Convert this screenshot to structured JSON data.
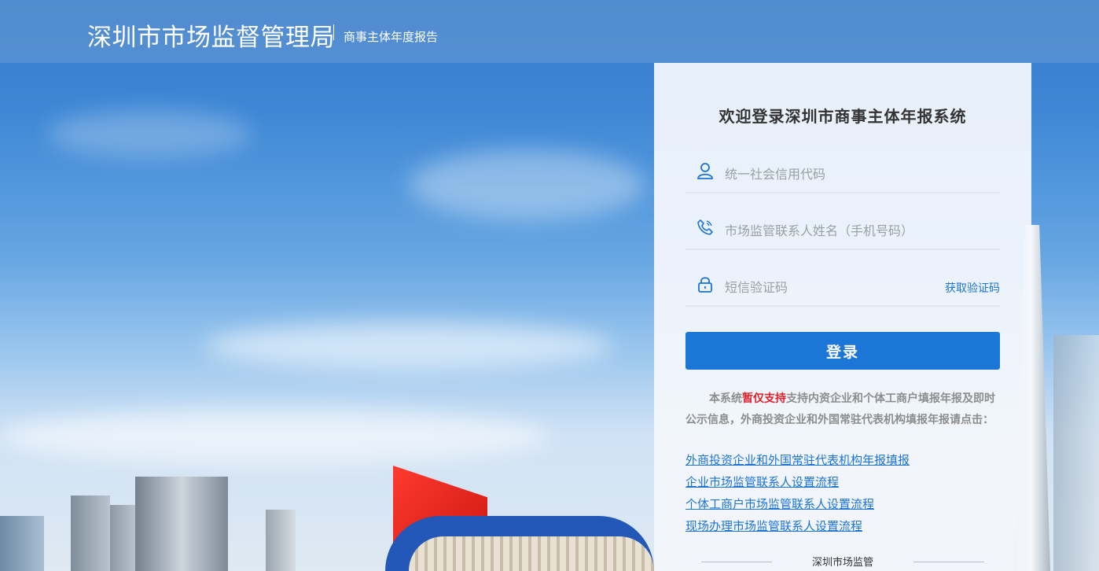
{
  "header": {
    "title": "深圳市市场监督管理局",
    "subtitle": "商事主体年度报告"
  },
  "login": {
    "welcome": "欢迎登录深圳市商事主体年报系统",
    "credit_code_placeholder": "统一社会信用代码",
    "contact_placeholder": "市场监管联系人姓名（手机号码）",
    "sms_placeholder": "短信验证码",
    "get_code_label": "获取验证码",
    "login_label": "登录"
  },
  "notice": {
    "prefix": "本系统",
    "highlight": "暂仅支持",
    "body": "支持内资企业和个体工商户填报年报及即时公示信息，外商投资企业和外国常驻代表机构填报年报请点击："
  },
  "links": [
    "外商投资企业和外国常驻代表机构年报填报",
    "企业市场监管联系人设置流程",
    "个体工商户市场监管联系人设置流程",
    "现场办理市场监管联系人设置流程"
  ],
  "footer": {
    "text": "深圳市场监管"
  },
  "colors": {
    "accent": "#1c76d8",
    "link": "#1b73d6",
    "highlight": "#e0202a"
  }
}
